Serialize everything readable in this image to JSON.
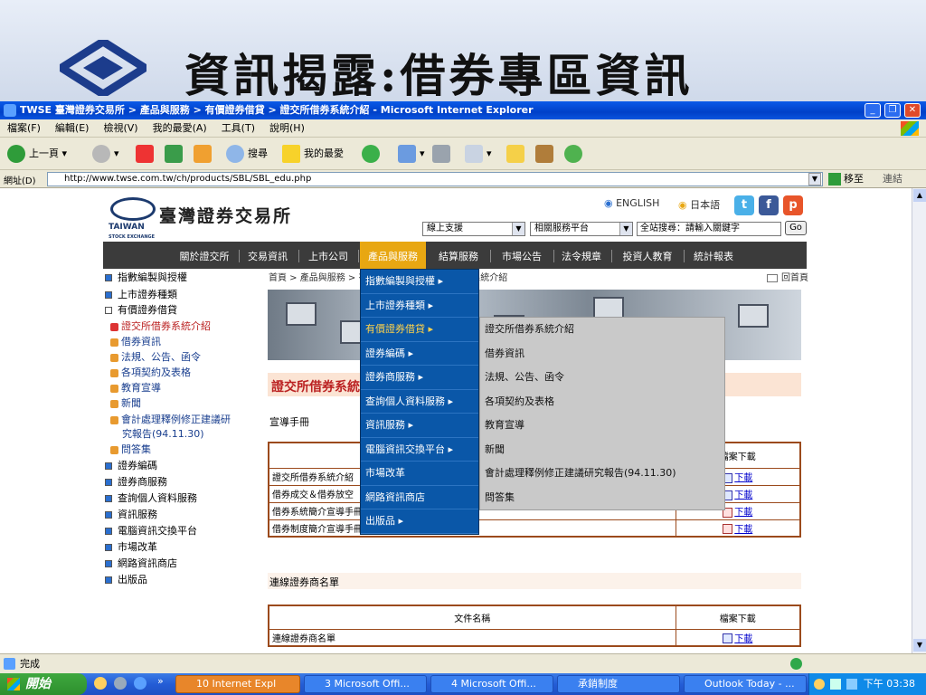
{
  "slide": {
    "title": "資訊揭露:借券專區資訊"
  },
  "window": {
    "title": "TWSE 臺灣證券交易所 > 產品與服務 > 有價證券借貸 > 證交所借券系統介紹 - Microsoft Internet Explorer"
  },
  "menubar": [
    "檔案(F)",
    "編輯(E)",
    "檢視(V)",
    "我的最愛(A)",
    "工具(T)",
    "說明(H)"
  ],
  "toolbar": {
    "back": "上一頁",
    "search": "搜尋",
    "favorites": "我的最愛"
  },
  "address": {
    "label": "網址(D)",
    "url": "http://www.twse.com.tw/ch/products/SBL/SBL_edu.php",
    "go": "移至",
    "links": "連結"
  },
  "site": {
    "logo_text": "臺灣證券交易所",
    "logo_en": "TAIWAN",
    "logo_en_sub": "STOCK EXCHANGE",
    "english": "ENGLISH",
    "japanese": "日本語",
    "select1": "線上支援",
    "select2": "相關服務平台",
    "search_placeholder": "全站搜尋：請輸入關鍵字",
    "go": "Go",
    "nav": [
      "關於證交所",
      "交易資訊",
      "上市公司",
      "產品與服務",
      "結算服務",
      "市場公告",
      "法令規章",
      "投資人教育",
      "統計報表"
    ],
    "sidebar_top": [
      "指數編製與授權",
      "上市證券種類",
      "有價證券借貸"
    ],
    "sidebar_sub": [
      "證交所借券系統介紹",
      "借券資訊",
      "法規、公告、函令",
      "各項契約及表格",
      "教育宣導",
      "新聞",
      "會計處理釋例修正建議研",
      "究報告(94.11.30)",
      "問答集"
    ],
    "sidebar_bottom": [
      "證券編碼",
      "證券商服務",
      "查詢個人資料服務",
      "資訊服務",
      "電腦資訊交換平台",
      "市場改革",
      "網路資訊商店",
      "出版品"
    ],
    "breadcrumb": "首頁 > 產品與服務 > 有價證券借貸 > 證交所借券系統介紹",
    "home": "回首頁",
    "heading": "證交所借券系統介紹",
    "section_label": "宣導手冊",
    "table1": {
      "col_file": "檔案下載",
      "rows": [
        "證交所借券系統介紹",
        "借券成交＆借券放空",
        "借券系統簡介宣導手冊",
        "借券制度簡介宣導手冊"
      ],
      "download": "下載"
    },
    "section2_label": "連線證券商名單",
    "table2": {
      "col_name": "文件名稱",
      "col_file": "檔案下載",
      "rows": [
        "連線證券商名單"
      ],
      "download": "下載"
    },
    "menu1": [
      "指數編製與授權",
      "上市證券種類",
      "有價證券借貸",
      "證券編碼",
      "證券商服務",
      "查詢個人資料服務",
      "資訊服務",
      "電腦資訊交換平台",
      "市場改革",
      "網路資訊商店",
      "出版品"
    ],
    "menu2": [
      "證交所借券系統介紹",
      "借券資訊",
      "法規、公告、函令",
      "各項契約及表格",
      "教育宣導",
      "新聞",
      "會計處理釋例修正建議研究報告(94.11.30)",
      "問答集"
    ]
  },
  "status": {
    "text": "完成"
  },
  "taskbar": {
    "start": "開始",
    "tasks": [
      "10 Internet Expl",
      "3 Microsoft Offi...",
      "4 Microsoft Offi...",
      "承銷制度",
      "Outlook Today - ..."
    ],
    "clock": "下午 03:38"
  },
  "colors": {
    "nav_active": "#e8a712",
    "menu_blue": "#0a57a8",
    "heading_red": "#b22222",
    "table_border": "#9b4a1c"
  }
}
